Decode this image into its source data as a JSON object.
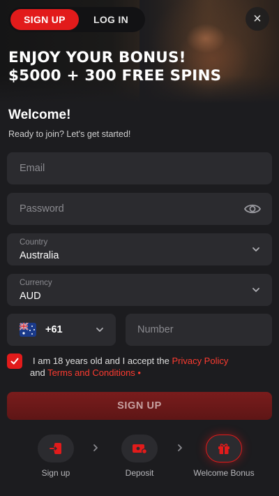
{
  "tabs": {
    "signup": "SIGN UP",
    "login": "LOG IN"
  },
  "close_icon_glyph": "×",
  "promo": {
    "line1": "ENJOY YOUR BONUS!",
    "line2": "$5000 + 300 FREE SPINS"
  },
  "welcome": {
    "title": "Welcome!",
    "subtitle": "Ready to join? Let's get started!"
  },
  "form": {
    "email_placeholder": "Email",
    "password_placeholder": "Password",
    "country": {
      "label": "Country",
      "value": "Australia"
    },
    "currency": {
      "label": "Currency",
      "value": "AUD"
    },
    "phone": {
      "code": "+61",
      "number_placeholder": "Number"
    },
    "terms": {
      "prefix": "I am 18 years old and I accept the ",
      "privacy": "Privacy Policy",
      "and": " and ",
      "conditions": "Terms and Conditions",
      "required_marker": " •"
    },
    "submit_label": "SIGN UP"
  },
  "steps": [
    {
      "label": "Sign up",
      "icon": "enter-icon"
    },
    {
      "label": "Deposit",
      "icon": "wallet-icon"
    },
    {
      "label": "Welcome Bonus",
      "icon": "gift-icon"
    }
  ],
  "colors": {
    "accent": "#e21b1b",
    "background": "#1c1c1f",
    "field": "#2b2b2f",
    "link": "#ff3b30"
  }
}
